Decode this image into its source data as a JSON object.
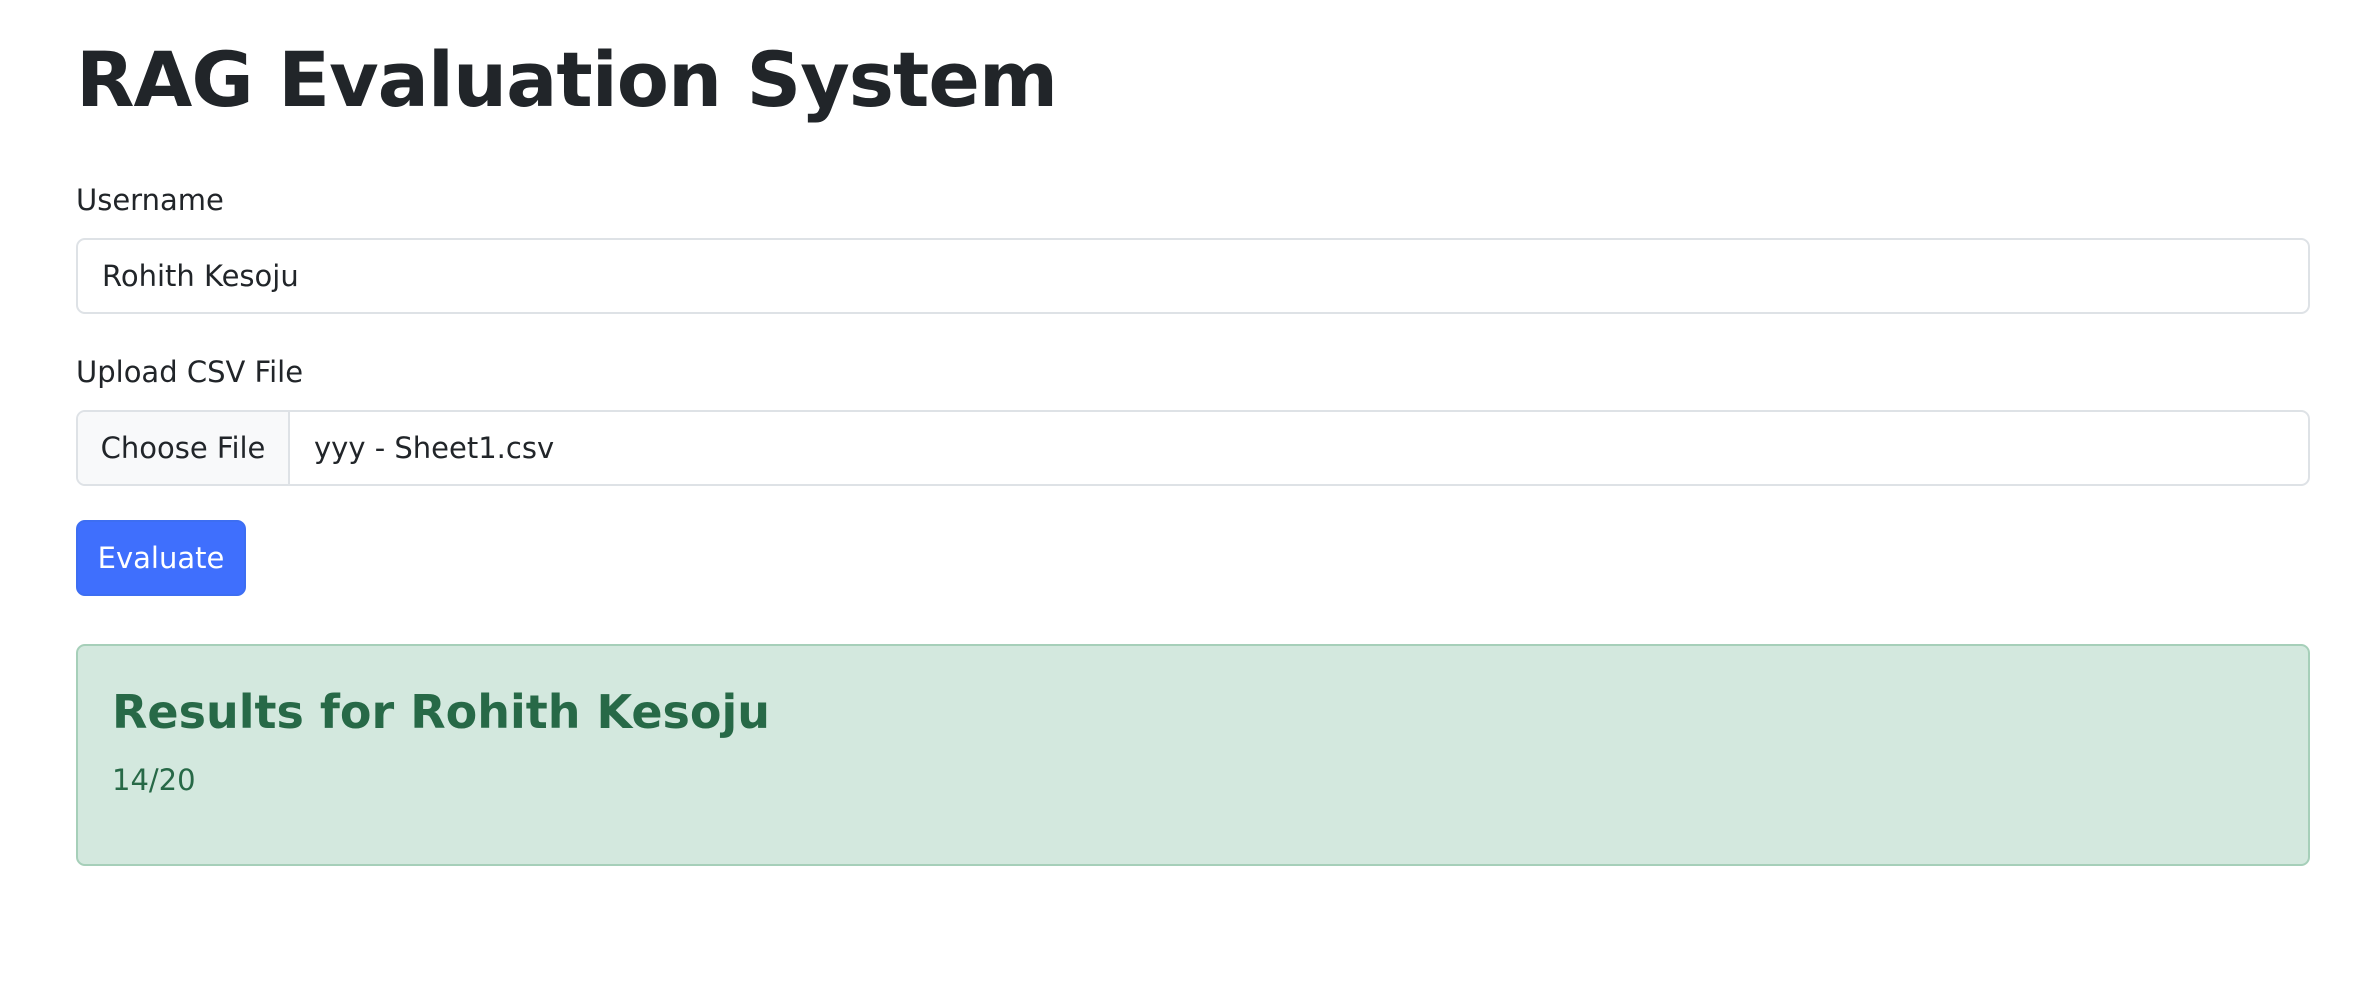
{
  "page": {
    "title": "RAG Evaluation System"
  },
  "form": {
    "username_label": "Username",
    "username_value": "Rohith Kesoju",
    "upload_label": "Upload CSV File",
    "choose_file_label": "Choose File",
    "selected_file": "yyy - Sheet1.csv",
    "evaluate_label": "Evaluate"
  },
  "results": {
    "title": "Results for Rohith Kesoju",
    "score": "14/20"
  },
  "colors": {
    "primary_button": "#3f6ffd",
    "success_background": "#d3e8de",
    "success_text": "#276947"
  }
}
